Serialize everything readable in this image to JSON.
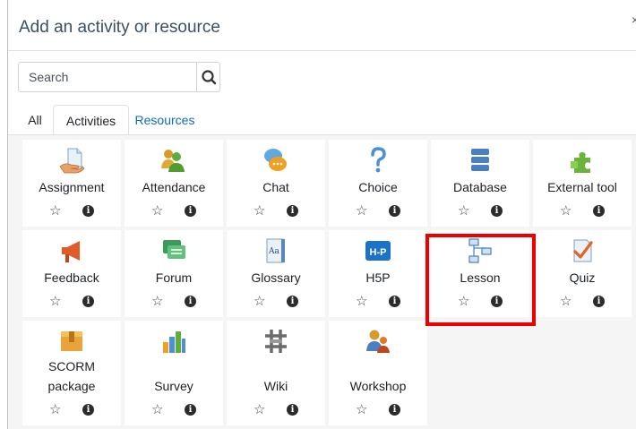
{
  "dialog": {
    "title": "Add an activity or resource",
    "close": "×"
  },
  "search": {
    "placeholder": "Search"
  },
  "tabs": [
    {
      "label": "All"
    },
    {
      "label": "Activities",
      "active": true
    },
    {
      "label": "Resources"
    }
  ],
  "tiles": [
    {
      "label": "Assignment",
      "icon": "assignment-icon"
    },
    {
      "label": "Attendance",
      "icon": "attendance-icon"
    },
    {
      "label": "Chat",
      "icon": "chat-icon"
    },
    {
      "label": "Choice",
      "icon": "choice-icon"
    },
    {
      "label": "Database",
      "icon": "database-icon"
    },
    {
      "label": "External tool",
      "icon": "external-tool-icon"
    },
    {
      "label": "Feedback",
      "icon": "feedback-icon"
    },
    {
      "label": "Forum",
      "icon": "forum-icon"
    },
    {
      "label": "Glossary",
      "icon": "glossary-icon"
    },
    {
      "label": "H5P",
      "icon": "h5p-icon"
    },
    {
      "label": "Lesson",
      "icon": "lesson-icon",
      "highlighted": true
    },
    {
      "label": "Quiz",
      "icon": "quiz-icon"
    },
    {
      "label_line1": "SCORM",
      "label_line2": "package",
      "icon": "scorm-icon"
    },
    {
      "label": "Survey",
      "icon": "survey-icon"
    },
    {
      "label": "Wiki",
      "icon": "wiki-icon"
    },
    {
      "label": "Workshop",
      "icon": "workshop-icon"
    }
  ],
  "h5p_badge": "H-P",
  "info_glyph": "i",
  "star_glyph": "☆"
}
